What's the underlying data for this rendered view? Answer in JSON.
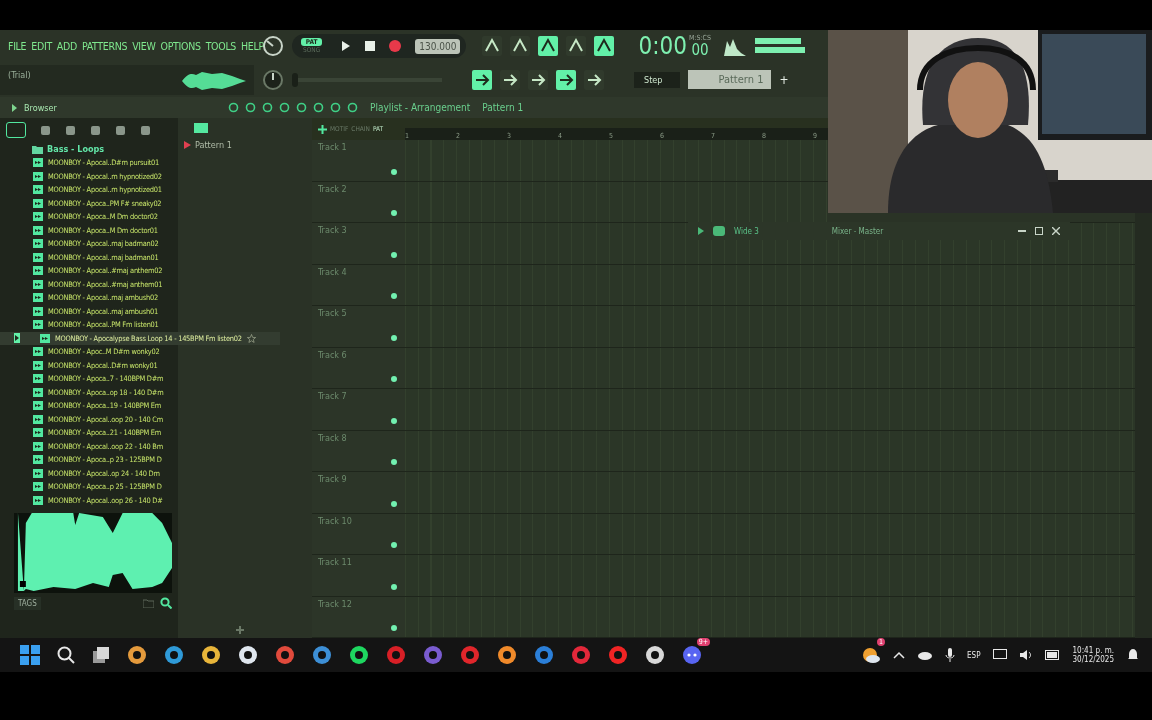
{
  "menu": [
    "FILE",
    "EDIT",
    "ADD",
    "PATTERNS",
    "VIEW",
    "OPTIONS",
    "TOOLS",
    "HELP"
  ],
  "hint_bar": {
    "text": "(Trial)"
  },
  "transport": {
    "modes": [
      {
        "label": "PAT",
        "selected": true
      },
      {
        "label": "SONG",
        "selected": false
      }
    ],
    "tempo": "130.000"
  },
  "time": {
    "value": "0:00",
    "centiseconds": "00",
    "unit": "M:S:CS"
  },
  "pitch": {
    "level": 0
  },
  "snap": {
    "label": "Step"
  },
  "pattern_selector": {
    "label": "Pattern 1",
    "plus": "+"
  },
  "browser": {
    "title": "Browser",
    "folder": "Bass - Loops",
    "files": [
      {
        "name": "MOONBOY - Apocal..D#m pursuit01",
        "selected": false
      },
      {
        "name": "MOONBOY - Apocal..m hypnotized02",
        "selected": false
      },
      {
        "name": "MOONBOY - Apocal..m hypnotized01",
        "selected": false
      },
      {
        "name": "MOONBOY - Apoca..PM F# sneaky02",
        "selected": false
      },
      {
        "name": "MOONBOY - Apoca..M Dm doctor02",
        "selected": false
      },
      {
        "name": "MOONBOY - Apoca..M Dm doctor01",
        "selected": false
      },
      {
        "name": "MOONBOY - Apocal..maj badman02",
        "selected": false
      },
      {
        "name": "MOONBOY - Apocal..maj badman01",
        "selected": false
      },
      {
        "name": "MOONBOY - Apocal..#maj anthem02",
        "selected": false
      },
      {
        "name": "MOONBOY - Apocal..#maj anthem01",
        "selected": false
      },
      {
        "name": "MOONBOY - Apocal..maj ambush02",
        "selected": false
      },
      {
        "name": "MOONBOY - Apocal..maj ambush01",
        "selected": false
      },
      {
        "name": "MOONBOY - Apocal..PM Fm listen01",
        "selected": false
      },
      {
        "name": "MOONBOY - Apocalypse Bass Loop 14 - 145BPM Fm listen02",
        "selected": true
      },
      {
        "name": "MOONBOY - Apoc..M D#m wonky02",
        "selected": false
      },
      {
        "name": "MOONBOY - Apocal..D#m wonky01",
        "selected": false
      },
      {
        "name": "MOONBOY - Apoca..7 - 140BPM D#m",
        "selected": false
      },
      {
        "name": "MOONBOY - Apoca..op 18 - 140 D#m",
        "selected": false
      },
      {
        "name": "MOONBOY - Apoca..19 - 140BPM Em",
        "selected": false
      },
      {
        "name": "MOONBOY - Apocal..oop 20 - 140 Cm",
        "selected": false
      },
      {
        "name": "MOONBOY - Apoca..21 - 140BPM Em",
        "selected": false
      },
      {
        "name": "MOONBOY - Apocal..oop 22 - 140 Bm",
        "selected": false
      },
      {
        "name": "MOONBOY - Apoca..p 23 - 125BPM D",
        "selected": false
      },
      {
        "name": "MOONBOY - Apocal..op 24 - 140 Dm",
        "selected": false
      },
      {
        "name": "MOONBOY - Apoca..p 25 - 125BPM D",
        "selected": false
      },
      {
        "name": "MOONBOY - Apocal..oop 26 - 140 D#",
        "selected": false
      }
    ],
    "tags": "TAGS"
  },
  "patterns": [
    "Pattern 1"
  ],
  "playlist": {
    "breadcrumb": [
      "Playlist - Arrangement",
      "Pattern 1"
    ],
    "modes": [
      "MOTIF",
      "CHAIN",
      "PAT"
    ],
    "ruler": [
      "1",
      "2",
      "3",
      "4",
      "5",
      "6",
      "7",
      "8",
      "9"
    ],
    "tracks": [
      "Track 1",
      "Track 2",
      "Track 3",
      "Track 4",
      "Track 5",
      "Track 6",
      "Track 7",
      "Track 8",
      "Track 9",
      "Track 10",
      "Track 11",
      "Track 12"
    ]
  },
  "mixer": {
    "preset": "Wide 3",
    "title": "Mixer - Master"
  },
  "webcam": {
    "kind": "picture"
  },
  "taskbar": {
    "badges": [
      "9+",
      "1"
    ],
    "language": "ESP",
    "clock": "10:41 p. m.",
    "date": "30/12/2025"
  }
}
